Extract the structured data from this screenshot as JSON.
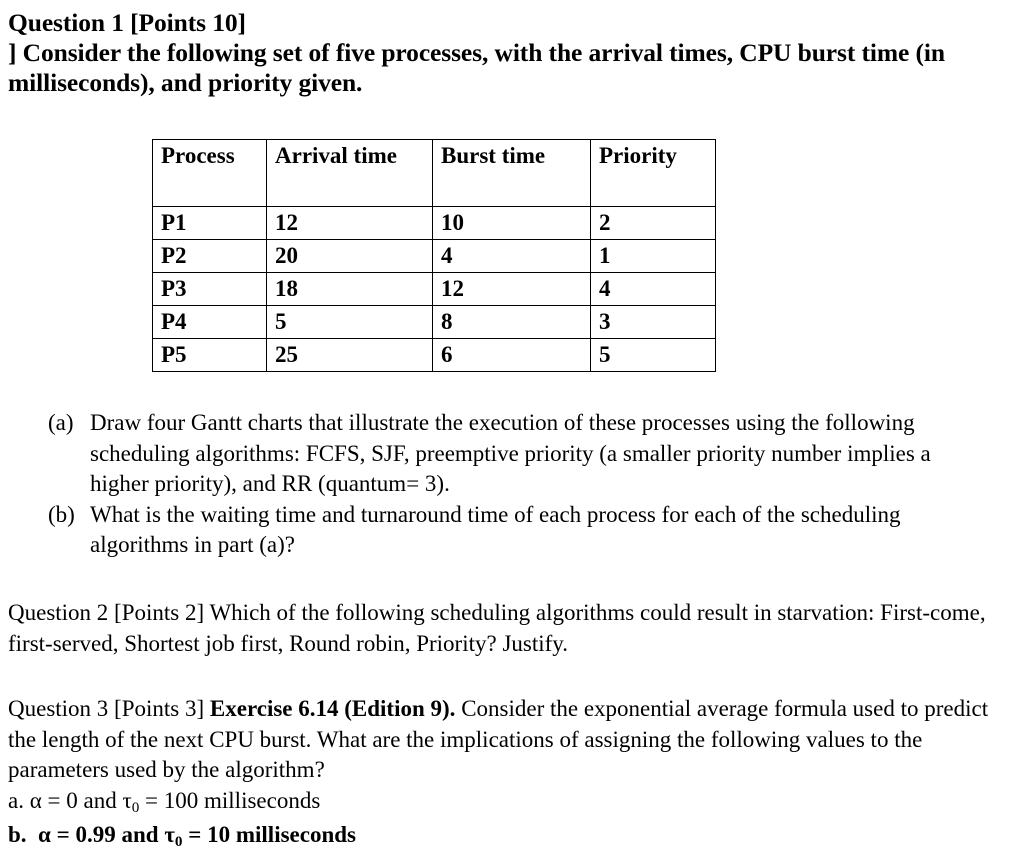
{
  "document": {
    "question1": {
      "heading_lines": [
        "Question 1 [Points 10]",
        "] Consider the following set of five processes, with the arrival times, CPU burst time (in milliseconds), and priority given."
      ],
      "table": {
        "headers": [
          "Process",
          "Arrival time",
          "Burst time",
          "Priority"
        ],
        "rows": [
          [
            "P1",
            "12",
            "10",
            "2"
          ],
          [
            "P2",
            "20",
            "4",
            "1"
          ],
          [
            "P3",
            "18",
            "12",
            "4"
          ],
          [
            "P4",
            "5",
            "8",
            "3"
          ],
          [
            "P5",
            "25",
            "6",
            "5"
          ]
        ]
      },
      "sub_items": [
        {
          "marker": "(a)",
          "text": "Draw four Gantt charts that illustrate the execution of these processes using the following scheduling algorithms: FCFS, SJF, preemptive priority (a smaller priority number implies a higher priority), and RR (quantum= 3)."
        },
        {
          "marker": "(b)",
          "text": " What is the waiting time and turnaround time of each process for each of the scheduling algorithms in part (a)?"
        }
      ]
    },
    "question2": {
      "text": "Question 2 [Points 2]  Which of the following scheduling algorithms could result in starvation: First-come, first-served, Shortest job first, Round robin, Priority? Justify."
    },
    "question3": {
      "prefix": "Question 3 [Points 3] ",
      "bold_reference": "Exercise 6.14 (Edition 9).",
      "body": " Consider the exponential average formula used to predict the length of the next CPU burst. What are the implications of assigning the following values to the parameters used by the algorithm?",
      "item_a": "a. α = 0 and τ",
      "item_a_sub": "0",
      "item_a_rest": " = 100 milliseconds",
      "item_b": "b.  α = 0.99 and τ",
      "item_b_sub": "0",
      "item_b_rest": " = 10 milliseconds"
    }
  }
}
